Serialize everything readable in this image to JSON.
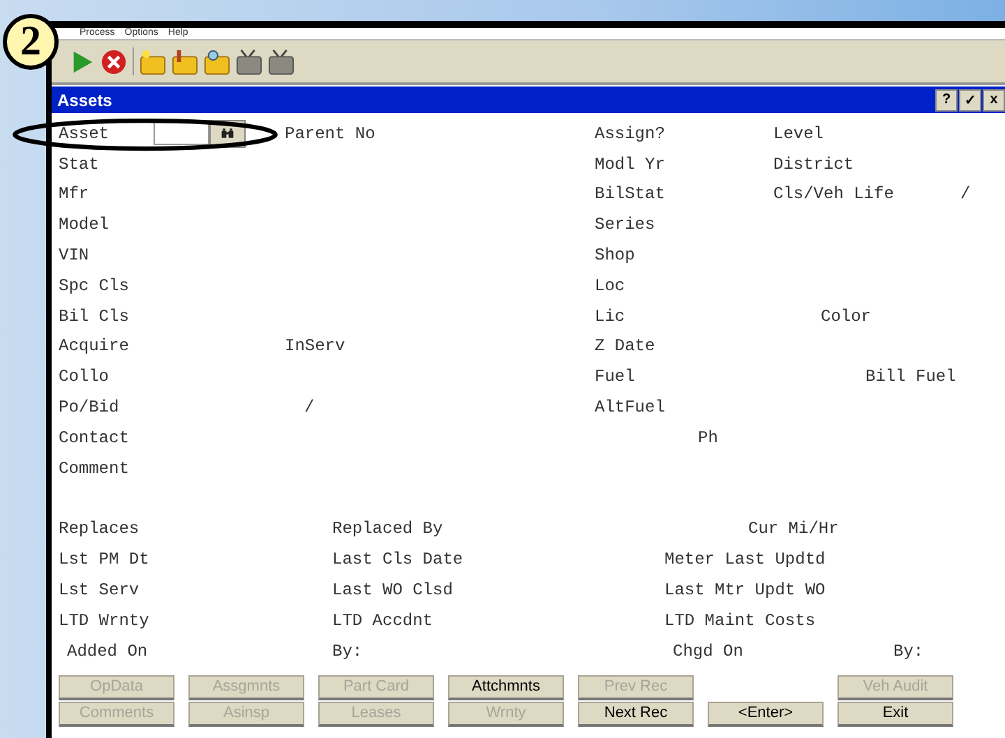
{
  "callout": {
    "number": "2"
  },
  "menu": [
    "Process",
    "Options",
    "Help"
  ],
  "toolbar": [
    {
      "kind": "run",
      "disabled": false
    },
    {
      "kind": "cancel",
      "disabled": false
    },
    {
      "kind": "new-folder",
      "disabled": false
    },
    {
      "kind": "edit-folder",
      "disabled": false
    },
    {
      "kind": "find-folder",
      "disabled": false
    },
    {
      "kind": "folder-x",
      "disabled": true
    },
    {
      "kind": "folder-x",
      "disabled": true
    }
  ],
  "window": {
    "title": "Assets",
    "title_buttons": [
      "?",
      "✓",
      "x"
    ]
  },
  "asset_field": {
    "label": "Asset"
  },
  "rows": [
    [
      "Parent No",
      "Assign?",
      "Level"
    ],
    [
      "Stat",
      "Modl Yr",
      "District"
    ],
    [
      "Mfr",
      "BilStat",
      "Cls/Veh Life",
      "/"
    ],
    [
      "Model",
      "Series"
    ],
    [
      "VIN",
      "Shop"
    ],
    [
      "Spc Cls",
      "Loc"
    ],
    [
      "Bil Cls",
      "Lic",
      "Color"
    ],
    [
      "Acquire",
      "InServ",
      "Z Date"
    ],
    [
      "Collo",
      "Fuel",
      "Bill Fuel"
    ],
    [
      "Po/Bid",
      "/",
      "AltFuel"
    ],
    [
      "Contact",
      "Ph"
    ],
    [
      "Comment"
    ],
    [
      "Replaces",
      "Replaced By",
      "Cur Mi/Hr"
    ],
    [
      "Lst PM Dt",
      "Last Cls Date",
      "Meter Last Updtd"
    ],
    [
      "Lst Serv",
      "Last WO Clsd",
      "Last Mtr Updt WO"
    ],
    [
      "LTD Wrnty",
      "LTD Accdnt",
      "LTD Maint Costs"
    ],
    [
      "Added On",
      "By:",
      "Chgd On",
      "By:"
    ]
  ],
  "buttons": [
    [
      {
        "label": "OpData",
        "disabled": true
      },
      {
        "label": "Assgmnts",
        "disabled": true
      },
      {
        "label": "Part Card",
        "disabled": true
      },
      {
        "label": "Attchmnts",
        "disabled": false
      },
      {
        "label": "Prev Rec",
        "disabled": true
      },
      {
        "label": "Veh Audit",
        "disabled": true
      }
    ],
    [
      {
        "label": "Comments",
        "disabled": true
      },
      {
        "label": "Asinsp",
        "disabled": true
      },
      {
        "label": "Leases",
        "disabled": true
      },
      {
        "label": "Wrnty",
        "disabled": true
      },
      {
        "label": "Next Rec",
        "disabled": false
      },
      {
        "label": "<Enter>",
        "disabled": false
      },
      {
        "label": "Exit",
        "disabled": false
      }
    ]
  ]
}
